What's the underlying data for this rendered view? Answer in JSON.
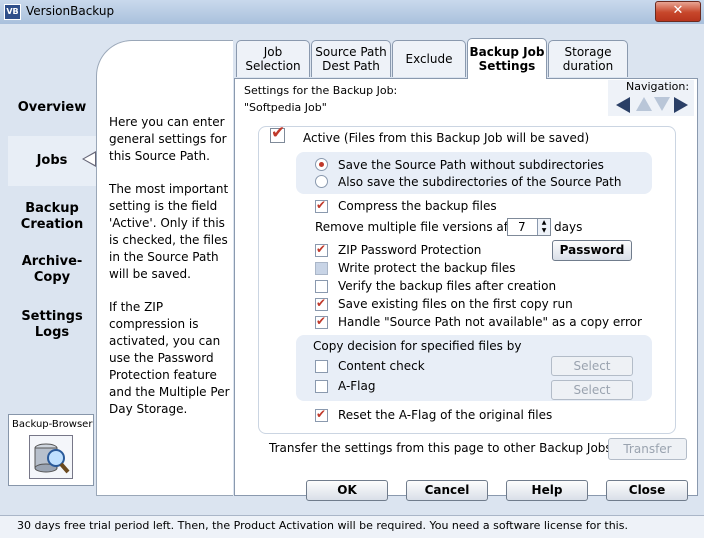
{
  "window": {
    "title": "VersionBackup",
    "icon_text": "VB",
    "close_label": "✕"
  },
  "nav": {
    "overview": "Overview",
    "jobs": "Jobs",
    "backup_creation": [
      "Backup",
      "Creation"
    ],
    "archive_copy": [
      "Archive-",
      "Copy"
    ],
    "settings_logs": [
      "Settings",
      "Logs"
    ]
  },
  "info": {
    "p1": "Here you can enter general settings for this Source Path.",
    "p2": "The most important setting is the field 'Active'. Only if this is checked, the files in the Source Path will be saved.",
    "p3": "If the ZIP compression is activated, you can use the Password Protection feature and the Multiple Per Day Storage."
  },
  "backup_browser": {
    "label": "Backup-Browser",
    "icon": "magnifier-disk-icon"
  },
  "tabs": [
    {
      "line1": "Job",
      "line2": "Selection"
    },
    {
      "line1": "Source Path",
      "line2": "Dest Path"
    },
    {
      "line1": "Exclude",
      "line2": ""
    },
    {
      "line1": "Backup Job",
      "line2": "Settings"
    },
    {
      "line1": "Storage",
      "line2": "duration"
    }
  ],
  "header": {
    "settings_for": "Settings for the Backup Job:",
    "job_name": "\"Softpedia Job\""
  },
  "navigation": {
    "label": "Navigation:"
  },
  "settings": {
    "active_label": "Active (Files from this Backup Job will be saved)",
    "active": true,
    "radio_without_sub": "Save the Source Path without subdirectories",
    "radio_with_sub": "Also save the subdirectories of the Source Path",
    "selected_radio": "without_sub",
    "compress": "Compress the backup files",
    "remove_prefix": "Remove multiple file versions after",
    "remove_days_value": "7",
    "remove_suffix": "days",
    "zip_password": "ZIP Password Protection",
    "password_button": "Password",
    "write_protect": "Write protect the backup files",
    "verify": "Verify the backup files after creation",
    "save_existing": "Save existing files on the first copy run",
    "handle_unavailable": "Handle \"Source Path not available\" as a copy error",
    "copy_decision": "Copy decision for specified files by",
    "content_check": "Content check",
    "a_flag": "A-Flag",
    "select_label": "Select",
    "reset_a_flag": "Reset the A-Flag of the original files"
  },
  "transfer": {
    "text": "Transfer the settings from this page to other Backup Jobs:",
    "button": "Transfer"
  },
  "buttons": {
    "ok": "OK",
    "cancel": "Cancel",
    "help": "Help",
    "close": "Close"
  },
  "status": "30 days free trial period left. Then, the Product Activation will be required. You need a software license for this.",
  "colors": {
    "accent_check": "#c0392b",
    "background": "#dbe4f0",
    "panel": "#ffffff"
  }
}
